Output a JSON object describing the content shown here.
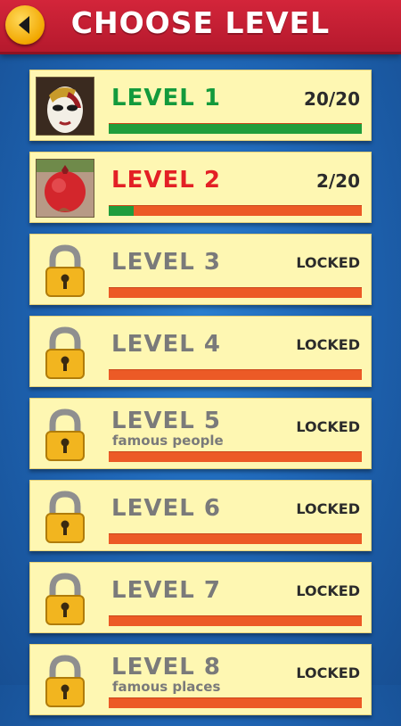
{
  "header": {
    "title": "CHOOSE LEVEL",
    "back_icon": "back-arrow-icon"
  },
  "colors": {
    "header": "#c9202f",
    "background": "#1f66b6",
    "card": "#fef7b2",
    "completed": "#139a3c",
    "current": "#e32025",
    "locked_text": "#7a7a7a",
    "progress_track": "#ec5a26",
    "progress_fill": "#1f9d3c"
  },
  "levels": [
    {
      "label": "LEVEL 1",
      "status": "20/20",
      "subtitle": "",
      "progress": 1.0,
      "thumb": "mask-thumbnail"
    },
    {
      "label": "LEVEL 2",
      "status": "2/20",
      "subtitle": "",
      "progress": 0.1,
      "thumb": "pomegranate-thumbnail"
    },
    {
      "label": "LEVEL 3",
      "status": "LOCKED",
      "subtitle": "",
      "progress": 0
    },
    {
      "label": "LEVEL 4",
      "status": "LOCKED",
      "subtitle": "",
      "progress": 0
    },
    {
      "label": "LEVEL 5",
      "status": "LOCKED",
      "subtitle": "famous people",
      "progress": 0
    },
    {
      "label": "LEVEL 6",
      "status": "LOCKED",
      "subtitle": "",
      "progress": 0
    },
    {
      "label": "LEVEL 7",
      "status": "LOCKED",
      "subtitle": "",
      "progress": 0
    },
    {
      "label": "LEVEL 8",
      "status": "LOCKED",
      "subtitle": "famous places",
      "progress": 0
    }
  ]
}
